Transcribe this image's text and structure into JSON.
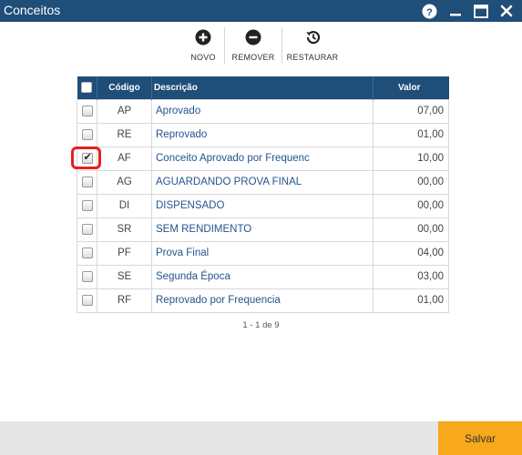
{
  "window": {
    "title": "Conceitos"
  },
  "toolbar": {
    "novo": "NOVO",
    "remover": "REMOVER",
    "restaurar": "RESTAURAR"
  },
  "table": {
    "headers": {
      "codigo": "Código",
      "descricao": "Descrição",
      "valor": "Valor"
    },
    "rows": [
      {
        "codigo": "AP",
        "descricao": "Aprovado",
        "valor": "07,00",
        "checked": false
      },
      {
        "codigo": "RE",
        "descricao": "Reprovado",
        "valor": "01,00",
        "checked": false
      },
      {
        "codigo": "AF",
        "descricao": "Conceito Aprovado por Frequenc",
        "valor": "10,00",
        "checked": true
      },
      {
        "codigo": "AG",
        "descricao": "AGUARDANDO PROVA FINAL",
        "valor": "00,00",
        "checked": false
      },
      {
        "codigo": "DI",
        "descricao": "DISPENSADO",
        "valor": "00,00",
        "checked": false
      },
      {
        "codigo": "SR",
        "descricao": "SEM RENDIMENTO",
        "valor": "00,00",
        "checked": false
      },
      {
        "codigo": "PF",
        "descricao": "Prova Final",
        "valor": "04,00",
        "checked": false
      },
      {
        "codigo": "SE",
        "descricao": "Segunda Época",
        "valor": "03,00",
        "checked": false
      },
      {
        "codigo": "RF",
        "descricao": "Reprovado por Frequencia",
        "valor": "01,00",
        "checked": false
      }
    ]
  },
  "pagination": {
    "text": "1 - 1 de 9"
  },
  "footer": {
    "save_label": "Salvar"
  },
  "colors": {
    "header_bg": "#1f4e79",
    "link_text": "#24558c",
    "save_button": "#f7a81b",
    "highlight": "#e52020"
  },
  "icons": {
    "novo": "plus-circle-icon",
    "remover": "minus-circle-icon",
    "restaurar": "history-icon",
    "help": "question-circle-icon",
    "minimize": "minimize-icon",
    "maximize": "maximize-icon",
    "close": "close-icon"
  }
}
